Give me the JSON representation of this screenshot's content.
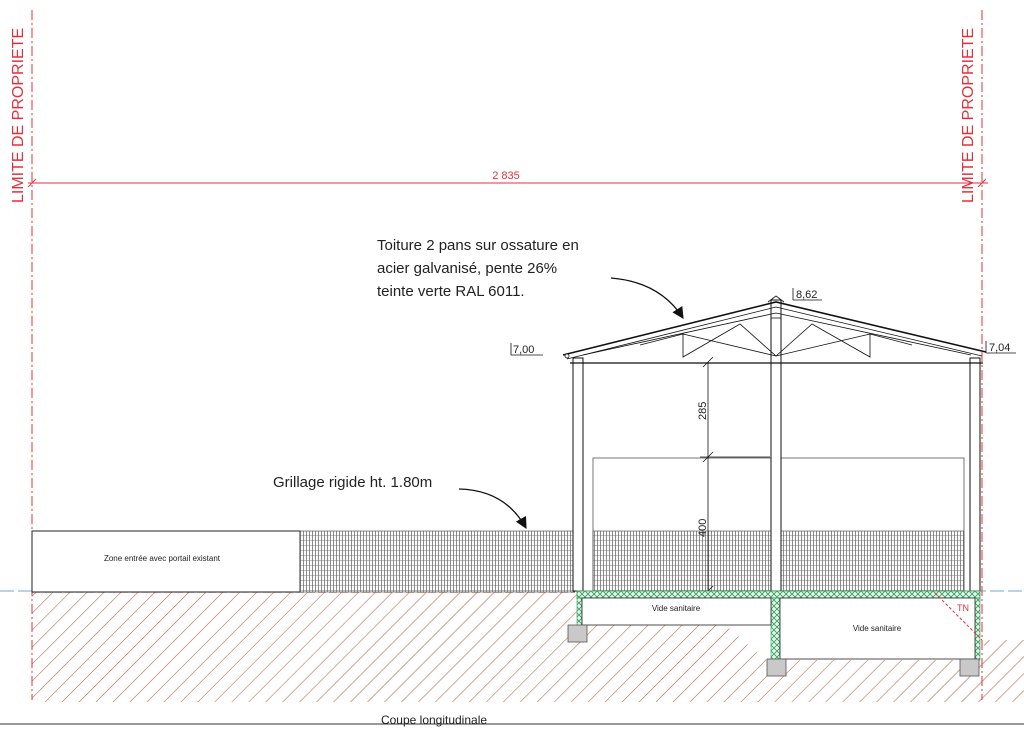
{
  "property_limit_label": "LIMITE DE PROPRIETE",
  "overall_dimension": "2 835",
  "roof_note": {
    "line1": "Toiture 2 pans sur ossature en",
    "line2": "acier galvanisé, pente 26%",
    "line3": "teinte verte RAL 6011."
  },
  "fence_note": "Grillage rigide ht. 1.80m",
  "levels": {
    "ridge": "8,62",
    "left_eave": "7,00",
    "right_eave": "7,04"
  },
  "dimensions": {
    "upper_height": "285",
    "lower_height": "400"
  },
  "entry_zone_label": "Zone entrée avec portail existant",
  "crawlspace_left": "Vide sanitaire",
  "crawlspace_right": "Vide sanitaire",
  "natural_ground": "TN",
  "caption": "Coupe longitudinale",
  "colors": {
    "property_limit": "#e0313a",
    "ground_hatch": "#b5614a",
    "foundation_green": "#2e9e5a",
    "ground_line": "#6fa8dc"
  }
}
